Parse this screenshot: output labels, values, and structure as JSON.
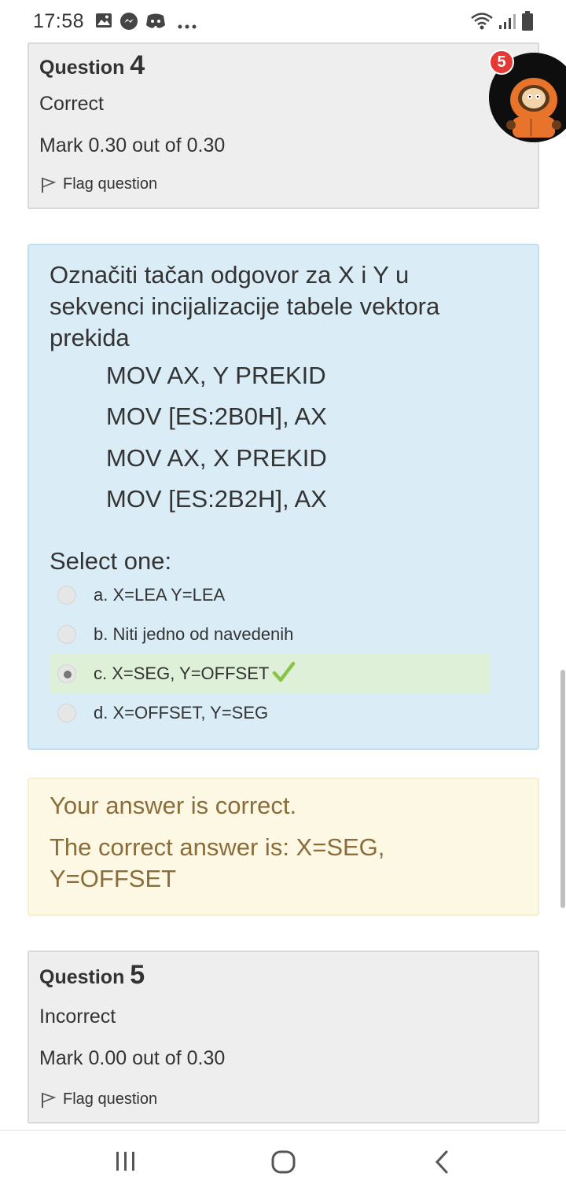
{
  "status_bar": {
    "time": "17:58",
    "left_icons": [
      "gallery-icon",
      "messenger-icon",
      "discord-icon",
      "more-icon"
    ],
    "right_icons": [
      "wifi-icon",
      "signal-icon",
      "battery-icon"
    ]
  },
  "question4": {
    "title_prefix": "Question",
    "number": "4",
    "state": "Correct",
    "mark": "Mark 0.30 out of 0.30",
    "flag_label": "Flag question"
  },
  "question_text": {
    "prompt": "Označiti tačan odgovor za X i Y u sekvenci incijalizacije tabele vektora prekida",
    "code_lines": [
      "MOV AX, Y PREKID",
      "MOV [ES:2B0H], AX",
      "MOV AX, X PREKID",
      "MOV [ES:2B2H], AX"
    ],
    "select_label": "Select one:",
    "options": [
      {
        "label": "a. X=LEA Y=LEA",
        "checked": false,
        "correct": false
      },
      {
        "label": "b. Niti jedno od navedenih",
        "checked": false,
        "correct": false
      },
      {
        "label": "c. X=SEG, Y=OFFSET",
        "checked": true,
        "correct": true
      },
      {
        "label": "d. X=OFFSET, Y=SEG",
        "checked": false,
        "correct": false
      }
    ]
  },
  "feedback": {
    "line1": "Your answer is correct.",
    "line2": "The correct answer is: X=SEG,",
    "line3": "Y=OFFSET"
  },
  "question5": {
    "title_prefix": "Question",
    "number": "5",
    "state": "Incorrect",
    "mark": "Mark 0.00 out of 0.30",
    "flag_label": "Flag question"
  },
  "chat_head": {
    "badge_count": "5",
    "icon": "avatar-icon"
  },
  "nav_bar": {
    "buttons": [
      "recents-icon",
      "home-icon",
      "back-icon"
    ]
  },
  "colors": {
    "info_bg": "#eeeeee",
    "question_bg": "#daedf7",
    "feedback_bg": "#fcf8e3",
    "feedback_text": "#8a6d3b",
    "selected_bg": "#dff0d8",
    "check_green": "#8bc34a",
    "badge_red": "#e53935"
  }
}
